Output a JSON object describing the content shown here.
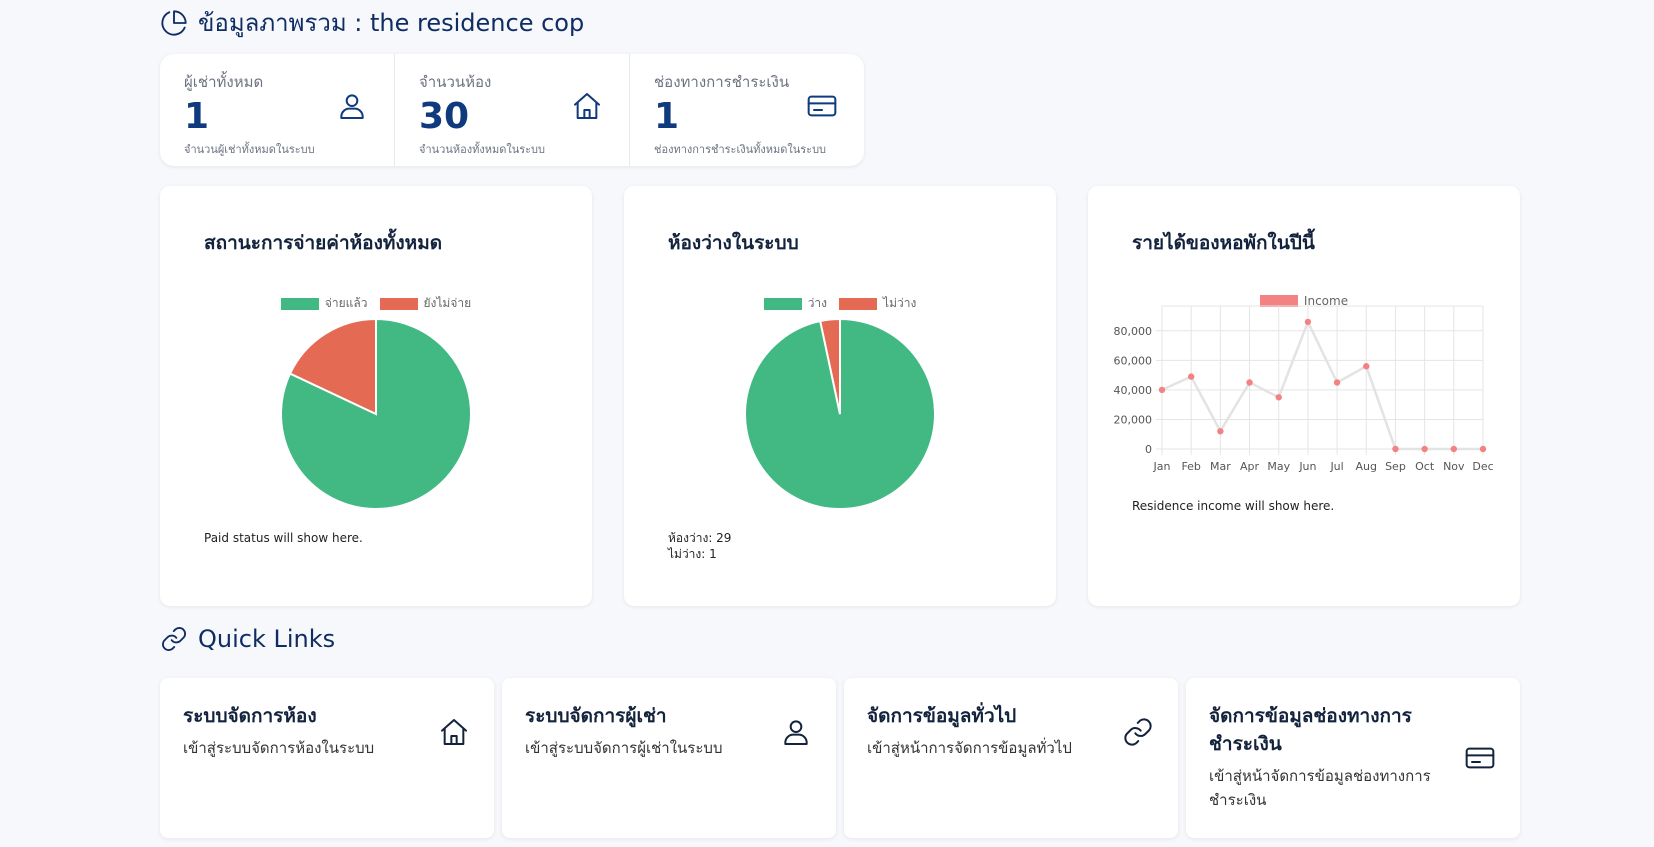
{
  "overview": {
    "title": "ข้อมูลภาพรวม : the residence cop"
  },
  "stats": [
    {
      "label": "ผู้เช่าทั้งหมด",
      "value": "1",
      "sub": "จำนวนผู้เช่าทั้งหมดในระบบ",
      "icon": "user-icon"
    },
    {
      "label": "จำนวนห้อง",
      "value": "30",
      "sub": "จำนวนห้องทั้งหมดในระบบ",
      "icon": "home-icon"
    },
    {
      "label": "ช่องทางการชำระเงิน",
      "value": "1",
      "sub": "ช่องทางการชำระเงินทั้งหมดในระบบ",
      "icon": "credit-card-icon"
    }
  ],
  "colors": {
    "green": "#42b883",
    "red": "#e56a54",
    "income": "#f38383",
    "navy": "#0f3a7d"
  },
  "paid_card": {
    "title": "สถานะการจ่ายค่าห้องทั้งหมด",
    "note": "Paid status will show here."
  },
  "vacancy_card": {
    "title": "ห้องว่างในระบบ",
    "note_vacant": "ห้องว่าง: 29",
    "note_occupied": "ไม่ว่าง: 1"
  },
  "income_card": {
    "title": "รายได้ของหอพักในปีนี้",
    "note": "Residence income will show here."
  },
  "chart_data": [
    {
      "type": "pie",
      "categories": [
        "จ่ายแล้ว",
        "ยังไม่จ่าย"
      ],
      "values": [
        82,
        18
      ],
      "colors": [
        "#42b883",
        "#e56a54"
      ],
      "legend": "top"
    },
    {
      "type": "pie",
      "categories": [
        "ว่าง",
        "ไม่ว่าง"
      ],
      "values": [
        29,
        1
      ],
      "colors": [
        "#42b883",
        "#e56a54"
      ],
      "legend": "top"
    },
    {
      "type": "line",
      "categories": [
        "Jan",
        "Feb",
        "Mar",
        "Apr",
        "May",
        "Jun",
        "Jul",
        "Aug",
        "Sep",
        "Oct",
        "Nov",
        "Dec"
      ],
      "series": [
        {
          "name": "Income",
          "values": [
            40000,
            49000,
            12000,
            45000,
            35000,
            86000,
            45000,
            56000,
            0,
            0,
            0,
            0
          ]
        }
      ],
      "yticks": [
        "0",
        "20,000",
        "40,000",
        "60,000",
        "80,000"
      ],
      "ylim": [
        0,
        90000
      ],
      "grid": true,
      "legend": "top"
    }
  ],
  "quick_links": {
    "title": "Quick Links",
    "items": [
      {
        "title": "ระบบจัดการห้อง",
        "desc": "เข้าสู่ระบบจัดการห้องในระบบ",
        "icon": "home-icon"
      },
      {
        "title": "ระบบจัดการผู้เช่า",
        "desc": "เข้าสู่ระบบจัดการผู้เช่าในระบบ",
        "icon": "user-icon"
      },
      {
        "title": "จัดการข้อมูลทั่วไป",
        "desc": "เข้าสู่หน้าการจัดการข้อมูลทั่วไป",
        "icon": "link-icon"
      },
      {
        "title": "จัดการข้อมูลช่องทางการชำระเงิน",
        "desc": "เข้าสู่หน้าจัดการข้อมูลช่องทางการชำระเงิน",
        "icon": "credit-card-icon"
      }
    ]
  }
}
